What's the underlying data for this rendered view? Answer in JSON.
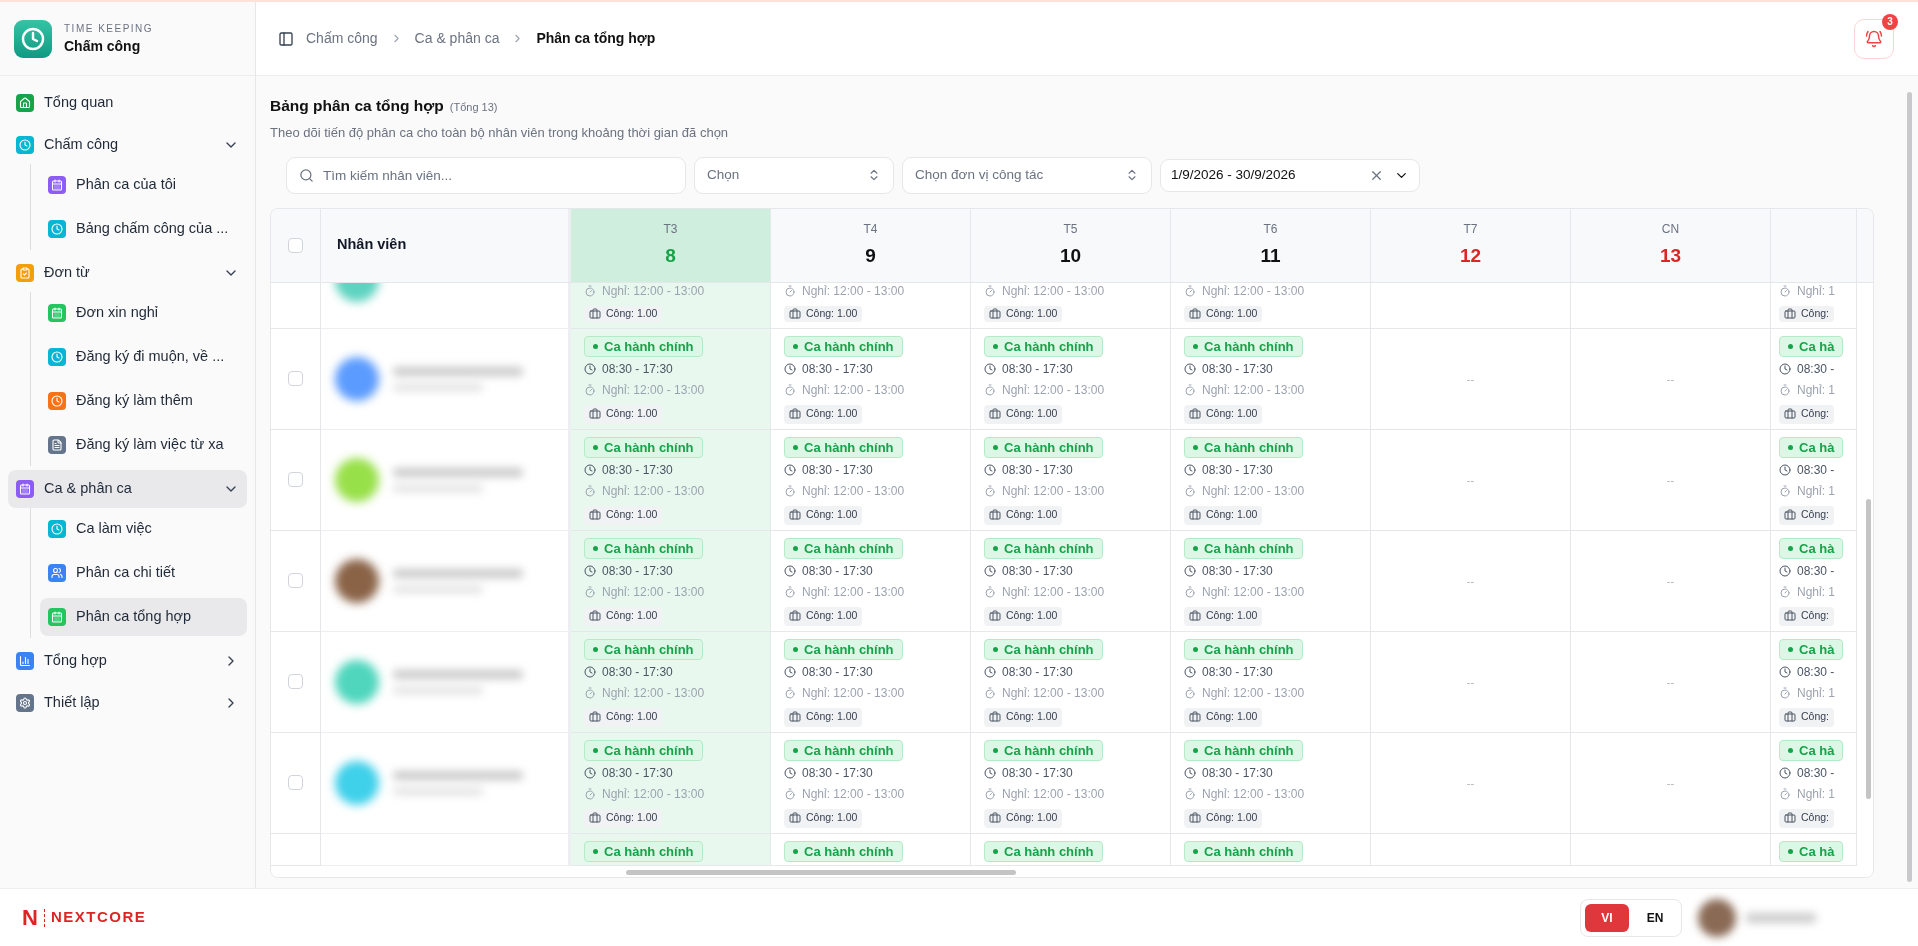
{
  "app": {
    "subtitle": "TIME KEEPING",
    "title": "Chấm công"
  },
  "sidebar": {
    "items": [
      {
        "label": "Tổng quan",
        "color": "#16a34a",
        "selected": false
      },
      {
        "label": "Chấm công",
        "color": "#06b6d4",
        "selected": false,
        "expanded": true,
        "children": [
          {
            "label": "Phân ca của tôi",
            "color": "#8b5cf6",
            "selected": false
          },
          {
            "label": "Bảng chấm công của ...",
            "color": "#06b6d4",
            "selected": false
          }
        ]
      },
      {
        "label": "Đơn từ",
        "color": "#f59e0b",
        "selected": false,
        "expanded": true,
        "children": [
          {
            "label": "Đơn xin nghỉ",
            "color": "#22c55e",
            "selected": false
          },
          {
            "label": "Đăng ký đi muộn, về ...",
            "color": "#06b6d4",
            "selected": false
          },
          {
            "label": "Đăng ký làm thêm",
            "color": "#f97316",
            "selected": false
          },
          {
            "label": "Đăng ký làm việc từ xa",
            "color": "#64748b",
            "selected": false
          }
        ]
      },
      {
        "label": "Ca & phân ca",
        "color": "#8b5cf6",
        "selected": true,
        "expanded": true,
        "children": [
          {
            "label": "Ca làm việc",
            "color": "#06b6d4",
            "selected": false
          },
          {
            "label": "Phân ca chi tiết",
            "color": "#3b82f6",
            "selected": false
          },
          {
            "label": "Phân ca tổng hợp",
            "color": "#22c55e",
            "selected": true
          }
        ]
      },
      {
        "label": "Tổng hợp",
        "color": "#3b82f6",
        "selected": false,
        "expanded": false
      },
      {
        "label": "Thiết lập",
        "color": "#64748b",
        "selected": false,
        "expanded": false
      }
    ]
  },
  "breadcrumb": [
    "Chấm công",
    "Ca & phân ca",
    "Phân ca tổng hợp"
  ],
  "notifications": {
    "count": "3"
  },
  "page": {
    "title": "Bảng phân ca tổng hợp",
    "total": "(Tổng 13)",
    "subtitle": "Theo dõi tiến độ phân ca cho toàn bộ nhân viên trong khoảng thời gian đã chọn"
  },
  "filters": {
    "search": {
      "placeholder": "Tìm kiếm nhân viên..."
    },
    "select_1": {
      "placeholder": "Chọn"
    },
    "unit": {
      "placeholder": "Chọn đơn vị công tác"
    },
    "date_range": {
      "value": "1/9/2026 - 30/9/2026"
    }
  },
  "table": {
    "employee_header": "Nhân viên",
    "select_all_checked": false,
    "columns": [
      {
        "day": "T3",
        "date": "8",
        "weekend": false,
        "today": true
      },
      {
        "day": "T4",
        "date": "9",
        "weekend": false,
        "today": false
      },
      {
        "day": "T5",
        "date": "10",
        "weekend": false,
        "today": false
      },
      {
        "day": "T6",
        "date": "11",
        "weekend": false,
        "today": false
      },
      {
        "day": "T7",
        "date": "12",
        "weekend": true,
        "today": false
      },
      {
        "day": "CN",
        "date": "13",
        "weekend": true,
        "today": false
      },
      {
        "today": false
      }
    ],
    "rows": [
      {
        "color": "#5fd3c0",
        "cells": [
          {
            "kind": "shift",
            "break": "Nghỉ: 12:00 - 13:00",
            "work": "Công: 1.00"
          },
          {
            "kind": "shift",
            "break": "Nghỉ: 12:00 - 13:00",
            "work": "Công: 1.00"
          },
          {
            "kind": "shift",
            "break": "Nghỉ: 12:00 - 13:00",
            "work": "Công: 1.00"
          },
          {
            "kind": "shift",
            "break": "Nghỉ: 12:00 - 13:00",
            "work": "Công: 1.00"
          },
          {
            "kind": "blank"
          },
          {
            "kind": "blank"
          },
          {
            "kind": "shift",
            "break": "Nghỉ: 1",
            "work": "Công:"
          }
        ]
      },
      {
        "checked": false,
        "color": "#5b9bff",
        "cells": [
          {
            "kind": "shift",
            "shift": "Ca hành chính",
            "time": "08:30 - 17:30",
            "break": "Nghỉ: 12:00 - 13:00",
            "work": "Công: 1.00"
          },
          {
            "kind": "shift",
            "shift": "Ca hành chính",
            "time": "08:30 - 17:30",
            "break": "Nghỉ: 12:00 - 13:00",
            "work": "Công: 1.00"
          },
          {
            "kind": "shift",
            "shift": "Ca hành chính",
            "time": "08:30 - 17:30",
            "break": "Nghỉ: 12:00 - 13:00",
            "work": "Công: 1.00"
          },
          {
            "kind": "shift",
            "shift": "Ca hành chính",
            "time": "08:30 - 17:30",
            "break": "Nghỉ: 12:00 - 13:00",
            "work": "Công: 1.00"
          },
          {
            "kind": "empty",
            "text": "--"
          },
          {
            "kind": "empty",
            "text": "--"
          },
          {
            "kind": "shift",
            "shift": "Ca hà",
            "time": "08:30 -",
            "break": "Nghỉ: 1",
            "work": "Công:"
          }
        ]
      },
      {
        "checked": false,
        "color": "#98e04a",
        "cells": [
          {
            "kind": "shift",
            "shift": "Ca hành chính",
            "time": "08:30 - 17:30",
            "break": "Nghỉ: 12:00 - 13:00",
            "work": "Công: 1.00"
          },
          {
            "kind": "shift",
            "shift": "Ca hành chính",
            "time": "08:30 - 17:30",
            "break": "Nghỉ: 12:00 - 13:00",
            "work": "Công: 1.00"
          },
          {
            "kind": "shift",
            "shift": "Ca hành chính",
            "time": "08:30 - 17:30",
            "break": "Nghỉ: 12:00 - 13:00",
            "work": "Công: 1.00"
          },
          {
            "kind": "shift",
            "shift": "Ca hành chính",
            "time": "08:30 - 17:30",
            "break": "Nghỉ: 12:00 - 13:00",
            "work": "Công: 1.00"
          },
          {
            "kind": "empty",
            "text": "--"
          },
          {
            "kind": "empty",
            "text": "--"
          },
          {
            "kind": "shift",
            "shift": "Ca hà",
            "time": "08:30 -",
            "break": "Nghỉ: 1",
            "work": "Công:"
          }
        ]
      },
      {
        "checked": false,
        "color": "#8a6347",
        "cells": [
          {
            "kind": "shift",
            "shift": "Ca hành chính",
            "time": "08:30 - 17:30",
            "break": "Nghỉ: 12:00 - 13:00",
            "work": "Công: 1.00"
          },
          {
            "kind": "shift",
            "shift": "Ca hành chính",
            "time": "08:30 - 17:30",
            "break": "Nghỉ: 12:00 - 13:00",
            "work": "Công: 1.00"
          },
          {
            "kind": "shift",
            "shift": "Ca hành chính",
            "time": "08:30 - 17:30",
            "break": "Nghỉ: 12:00 - 13:00",
            "work": "Công: 1.00"
          },
          {
            "kind": "shift",
            "shift": "Ca hành chính",
            "time": "08:30 - 17:30",
            "break": "Nghỉ: 12:00 - 13:00",
            "work": "Công: 1.00"
          },
          {
            "kind": "empty",
            "text": "--"
          },
          {
            "kind": "empty",
            "text": "--"
          },
          {
            "kind": "shift",
            "shift": "Ca hà",
            "time": "08:30 -",
            "break": "Nghỉ: 1",
            "work": "Công:"
          }
        ]
      },
      {
        "checked": false,
        "color": "#4fd6bd",
        "cells": [
          {
            "kind": "shift",
            "shift": "Ca hành chính",
            "time": "08:30 - 17:30",
            "break": "Nghỉ: 12:00 - 13:00",
            "work": "Công: 1.00"
          },
          {
            "kind": "shift",
            "shift": "Ca hành chính",
            "time": "08:30 - 17:30",
            "break": "Nghỉ: 12:00 - 13:00",
            "work": "Công: 1.00"
          },
          {
            "kind": "shift",
            "shift": "Ca hành chính",
            "time": "08:30 - 17:30",
            "break": "Nghỉ: 12:00 - 13:00",
            "work": "Công: 1.00"
          },
          {
            "kind": "shift",
            "shift": "Ca hành chính",
            "time": "08:30 - 17:30",
            "break": "Nghỉ: 12:00 - 13:00",
            "work": "Công: 1.00"
          },
          {
            "kind": "empty",
            "text": "--"
          },
          {
            "kind": "empty",
            "text": "--"
          },
          {
            "kind": "shift",
            "shift": "Ca hà",
            "time": "08:30 -",
            "break": "Nghỉ: 1",
            "work": "Công:"
          }
        ]
      },
      {
        "checked": false,
        "color": "#3fd0ea",
        "cells": [
          {
            "kind": "shift",
            "shift": "Ca hành chính",
            "time": "08:30 - 17:30",
            "break": "Nghỉ: 12:00 - 13:00",
            "work": "Công: 1.00"
          },
          {
            "kind": "shift",
            "shift": "Ca hành chính",
            "time": "08:30 - 17:30",
            "break": "Nghỉ: 12:00 - 13:00",
            "work": "Công: 1.00"
          },
          {
            "kind": "shift",
            "shift": "Ca hành chính",
            "time": "08:30 - 17:30",
            "break": "Nghỉ: 12:00 - 13:00",
            "work": "Công: 1.00"
          },
          {
            "kind": "shift",
            "shift": "Ca hành chính",
            "time": "08:30 - 17:30",
            "break": "Nghỉ: 12:00 - 13:00",
            "work": "Công: 1.00"
          },
          {
            "kind": "empty",
            "text": "--"
          },
          {
            "kind": "empty",
            "text": "--"
          },
          {
            "kind": "shift",
            "shift": "Ca hà",
            "time": "08:30 -",
            "break": "Nghỉ: 1",
            "work": "Công:"
          }
        ]
      },
      {
        "cells": [
          {
            "kind": "shift",
            "shift": "Ca hành chính"
          },
          {
            "kind": "shift",
            "shift": "Ca hành chính"
          },
          {
            "kind": "shift",
            "shift": "Ca hành chính"
          },
          {
            "kind": "shift",
            "shift": "Ca hành chính"
          },
          {
            "kind": "blank"
          },
          {
            "kind": "blank"
          },
          {
            "kind": "shift",
            "shift": "Ca hà"
          }
        ]
      }
    ]
  },
  "footer": {
    "logo_mark": "N",
    "brand": "NEXTCORE",
    "languages": [
      {
        "label": "VI",
        "selected": true
      },
      {
        "label": "EN",
        "selected": false
      }
    ]
  }
}
